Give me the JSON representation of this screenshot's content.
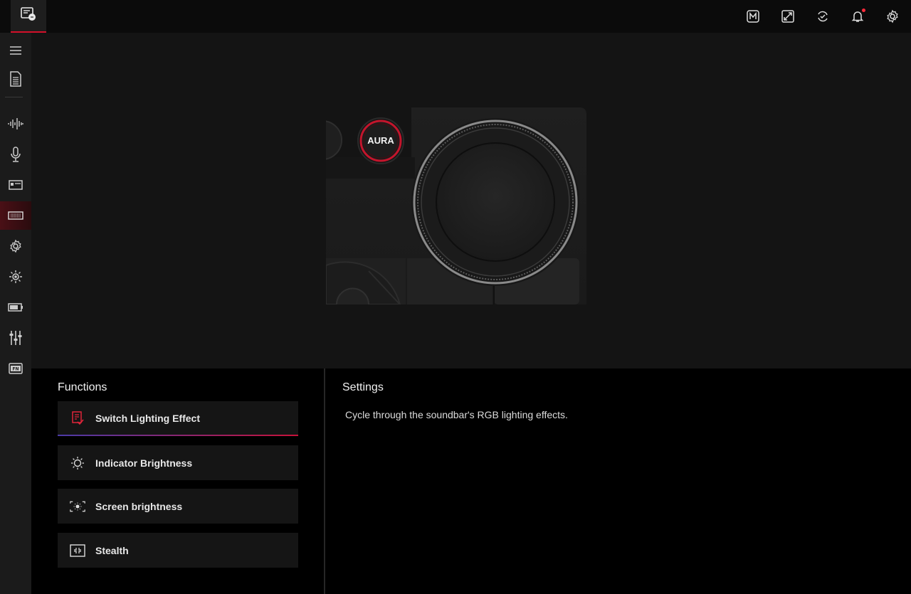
{
  "topbar": {
    "app_icon": "device-icon",
    "icons": [
      "macro-icon",
      "scenario-profile-icon",
      "update-icon",
      "notification-icon",
      "settings-icon"
    ],
    "accent": "#d4102a"
  },
  "sidebar": {
    "items": [
      {
        "icon": "menu-icon"
      },
      {
        "icon": "document-icon"
      },
      {
        "icon": "audio-wave-icon"
      },
      {
        "icon": "microphone-icon"
      },
      {
        "icon": "display-icon"
      },
      {
        "icon": "keyboard-icon",
        "active": true
      },
      {
        "icon": "gear-icon"
      },
      {
        "icon": "brightness-icon"
      },
      {
        "icon": "battery-icon"
      },
      {
        "icon": "equalizer-icon"
      },
      {
        "icon": "fn-key-icon"
      }
    ]
  },
  "preview": {
    "aura_label": "AURA"
  },
  "functions": {
    "title": "Functions",
    "items": [
      {
        "label": "Switch Lighting Effect",
        "icon": "lighting-effect-icon",
        "active": true
      },
      {
        "label": "Indicator Brightness",
        "icon": "sun-icon"
      },
      {
        "label": "Screen brightness",
        "icon": "screen-brightness-icon"
      },
      {
        "label": "Stealth",
        "icon": "stealth-icon"
      }
    ]
  },
  "settings": {
    "title": "Settings",
    "description": "Cycle through the soundbar's RGB lighting effects."
  }
}
